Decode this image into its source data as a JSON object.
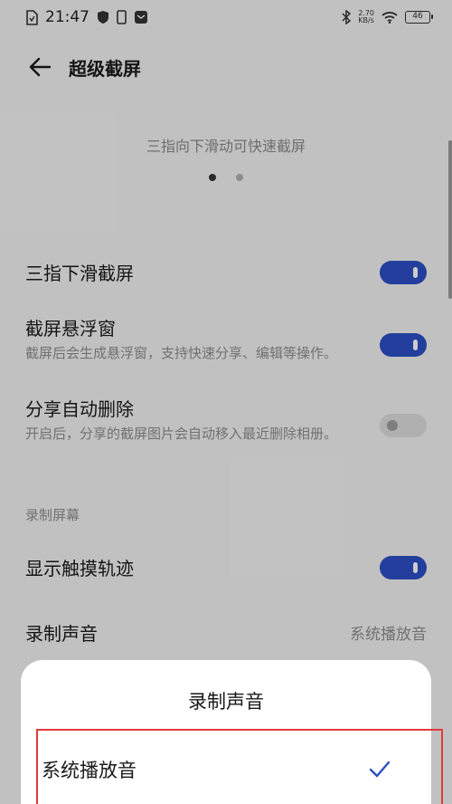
{
  "status_bar": {
    "time": "21:47",
    "net_speed_value": "2.70",
    "net_speed_unit": "KB/s",
    "battery": "46"
  },
  "header": {
    "title": "超级截屏"
  },
  "preview": {
    "caption": "三指向下滑动可快速截屏",
    "page_count": 2,
    "active_page": 1
  },
  "settings": {
    "three_finger": {
      "title": "三指下滑截屏",
      "enabled": true
    },
    "float_window": {
      "title": "截屏悬浮窗",
      "desc": "截屏后会生成悬浮窗，支持快速分享、编辑等操作。",
      "enabled": true
    },
    "auto_delete": {
      "title": "分享自动删除",
      "desc": "开启后，分享的截屏图片会自动移入最近删除相册。",
      "enabled": false
    },
    "section_record": "录制屏幕",
    "touch_track": {
      "title": "显示触摸轨迹",
      "enabled": true
    },
    "record_sound": {
      "title": "录制声音",
      "value": "系统播放音"
    }
  },
  "sheet": {
    "title": "录制声音",
    "options": [
      {
        "label": "系统播放音",
        "selected": true
      }
    ]
  },
  "colors": {
    "accent": "#2c4ec4",
    "highlight_border": "#e03a3a"
  }
}
